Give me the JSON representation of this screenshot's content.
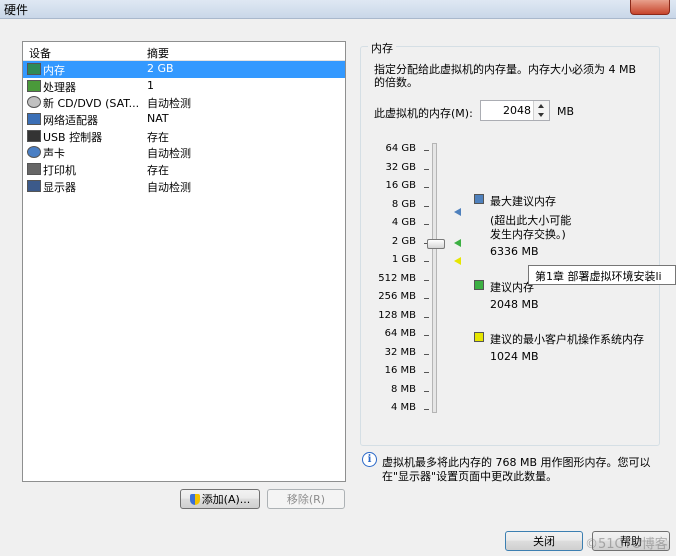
{
  "window": {
    "title": "硬件"
  },
  "devices": {
    "header": {
      "device": "设备",
      "summary": "摘要"
    },
    "rows": [
      {
        "name": "内存",
        "summary": "2 GB",
        "icon": "memory-icon"
      },
      {
        "name": "处理器",
        "summary": "1",
        "icon": "cpu-icon"
      },
      {
        "name": "新 CD/DVD (SAT...",
        "summary": "自动检测",
        "icon": "cd-dvd-icon"
      },
      {
        "name": "网络适配器",
        "summary": "NAT",
        "icon": "network-adapter-icon"
      },
      {
        "name": "USB 控制器",
        "summary": "存在",
        "icon": "usb-icon"
      },
      {
        "name": "声卡",
        "summary": "自动检测",
        "icon": "sound-card-icon"
      },
      {
        "name": "打印机",
        "summary": "存在",
        "icon": "printer-icon"
      },
      {
        "name": "显示器",
        "summary": "自动检测",
        "icon": "display-icon"
      }
    ],
    "selected_index": 0
  },
  "buttons": {
    "add": "添加(A)...",
    "remove": "移除(R)",
    "close": "关闭",
    "help": "帮助"
  },
  "memory": {
    "group_title": "内存",
    "description_1": "指定分配给此虚拟机的内存量。内存大小必须为 4 MB",
    "description_2": "的倍数。",
    "field_label": "此虚拟机的内存(M):",
    "value": "2048",
    "unit": "MB",
    "scale": [
      "64 GB",
      "32 GB",
      "16 GB",
      "8 GB",
      "4 GB",
      "2 GB",
      "1 GB",
      "512 MB",
      "256 MB",
      "128 MB",
      "64 MB",
      "32 MB",
      "16 MB",
      "8 MB",
      "4 MB"
    ],
    "slider_value_mb": 2048,
    "legend": {
      "max_title": "最大建议内存",
      "max_note_1": "(超出此大小可能",
      "max_note_2": "发生内存交换。)",
      "max_value": "6336 MB",
      "rec_title": "建议内存",
      "rec_value": "2048 MB",
      "min_title": "建议的最小客户机操作系统内存",
      "min_value": "1024 MB"
    },
    "info_1": "虚拟机最多将此内存的 768 MB 用作图形内存。您可以",
    "info_2": "在\"显示器\"设置页面中更改此数量。"
  },
  "tooltip": "第1章 部署虚拟环境安装li",
  "watermark": "©51CTO博客",
  "colors": {
    "selection": "#3399ff",
    "max_marker": "#4f81bd",
    "rec_marker": "#3cb043",
    "min_marker": "#e6e600"
  }
}
